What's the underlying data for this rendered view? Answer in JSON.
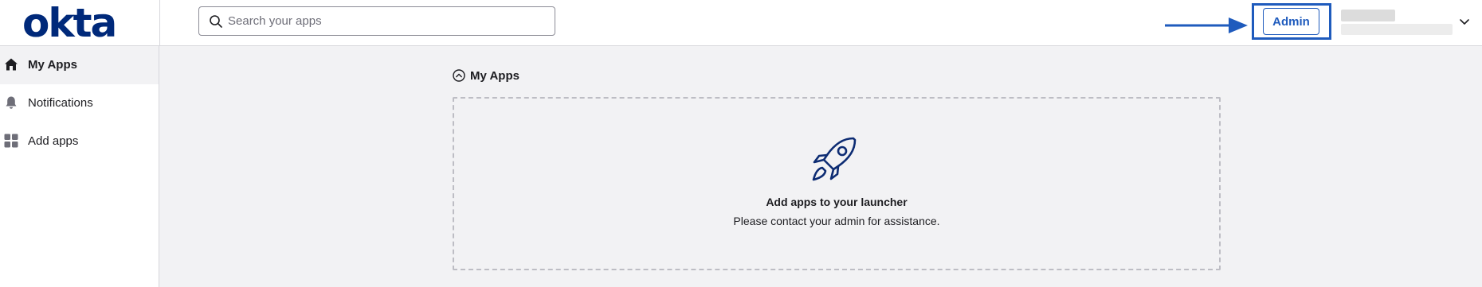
{
  "brand": {
    "logo_text": "okta",
    "color": "#00297a"
  },
  "search": {
    "placeholder": "Search your apps",
    "value": ""
  },
  "header": {
    "admin_label": "Admin",
    "accent": "#1f5bbd"
  },
  "sidebar": {
    "items": [
      {
        "label": "My Apps",
        "icon": "home-icon",
        "active": true
      },
      {
        "label": "Notifications",
        "icon": "bell-icon",
        "active": false
      },
      {
        "label": "Add apps",
        "icon": "grid-icon",
        "active": false
      }
    ]
  },
  "main": {
    "section_title": "My Apps",
    "empty_state": {
      "icon": "rocket-icon",
      "title": "Add apps to your launcher",
      "subtitle": "Please contact your admin for assistance."
    }
  }
}
